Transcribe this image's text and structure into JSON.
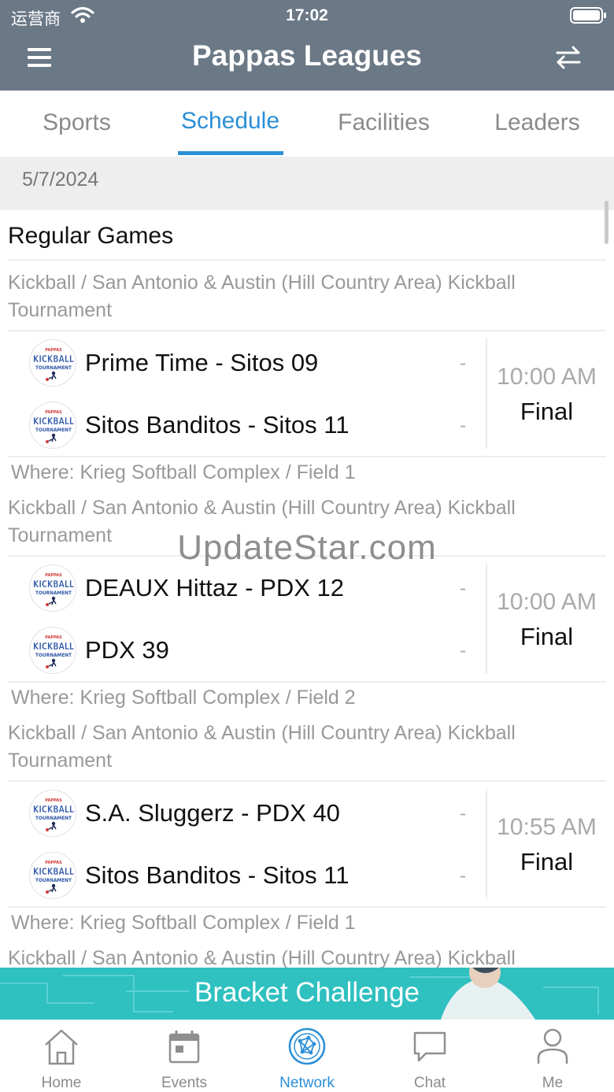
{
  "status_bar": {
    "carrier": "运营商",
    "time": "17:02"
  },
  "header": {
    "title": "Pappas Leagues"
  },
  "tabs": [
    {
      "label": "Sports",
      "active": false
    },
    {
      "label": "Schedule",
      "active": true
    },
    {
      "label": "Facilities",
      "active": false
    },
    {
      "label": "Leaders",
      "active": false
    }
  ],
  "date": "5/7/2024",
  "section_title": "Regular Games",
  "logo_text": {
    "top": "PAPPAS",
    "main": "KICKBALL",
    "bottom": "TOURNAMENT"
  },
  "games": [
    {
      "league": "Kickball / San Antonio & Austin (Hill Country Area) Kickball Tournament",
      "team1": {
        "name": "Prime Time - Sitos 09",
        "score": "-"
      },
      "team2": {
        "name": "Sitos Banditos - Sitos 11",
        "score": "-"
      },
      "time": "10:00 AM",
      "status": "Final",
      "where": "Where: Krieg Softball Complex / Field 1"
    },
    {
      "league": "Kickball / San Antonio & Austin (Hill Country Area) Kickball Tournament",
      "team1": {
        "name": "DEAUX Hittaz - PDX 12",
        "score": "-"
      },
      "team2": {
        "name": "PDX 39",
        "score": "-"
      },
      "time": "10:00 AM",
      "status": "Final",
      "where": "Where: Krieg Softball Complex / Field 2"
    },
    {
      "league": "Kickball / San Antonio & Austin (Hill Country Area) Kickball Tournament",
      "team1": {
        "name": "S.A. Sluggerz - PDX 40",
        "score": "-"
      },
      "team2": {
        "name": "Sitos Banditos - Sitos 11",
        "score": "-"
      },
      "time": "10:55 AM",
      "status": "Final",
      "where": "Where: Krieg Softball Complex / Field 1"
    },
    {
      "league": "Kickball / San Antonio & Austin (Hill Country Area) Kickball"
    }
  ],
  "watermark": "UpdateStar.com",
  "banner": {
    "label": "Bracket Challenge"
  },
  "tabbar": [
    {
      "label": "Home",
      "icon": "home-icon",
      "active": false
    },
    {
      "label": "Events",
      "icon": "calendar-icon",
      "active": false
    },
    {
      "label": "Network",
      "icon": "network-icon",
      "active": true
    },
    {
      "label": "Chat",
      "icon": "chat-icon",
      "active": false
    },
    {
      "label": "Me",
      "icon": "person-icon",
      "active": false
    }
  ],
  "colors": {
    "header_bg": "#6b7886",
    "accent": "#2b8fd6",
    "banner_bg": "#2fc0c0",
    "date_bar_bg": "#eeeeee",
    "muted_text": "#999999",
    "logo_blue": "#2f57a8",
    "logo_red": "#d23a3a"
  }
}
